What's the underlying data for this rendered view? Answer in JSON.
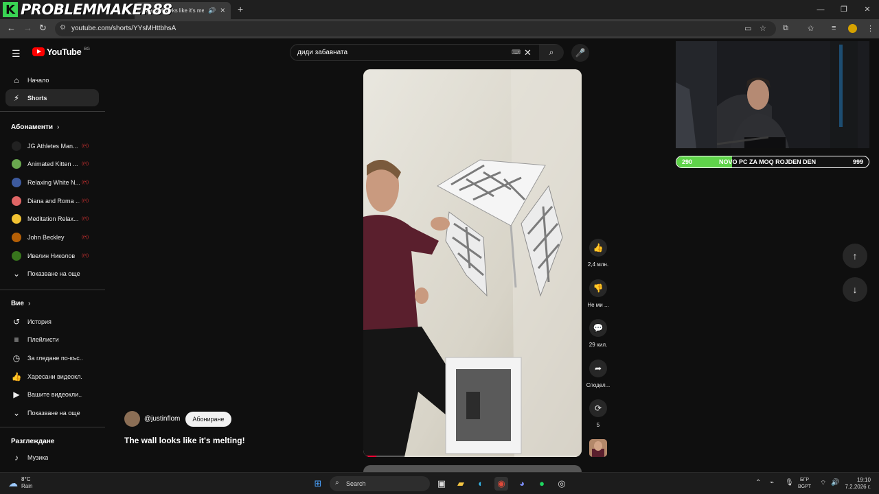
{
  "overlay": {
    "brand_letter": "K",
    "brand_name": "PROBLEMMAKER88"
  },
  "browser": {
    "tab_title": "The wall looks like it's melting",
    "url": "youtube.com/shorts/YYsMHttbhsA",
    "window_controls": [
      "—",
      "❐",
      "✕"
    ]
  },
  "youtube": {
    "logo_text": "YouTube",
    "region": "BG",
    "search_value": "диди забавната",
    "nav": [
      {
        "label": "Начало",
        "icon": "home-icon"
      },
      {
        "label": "Shorts",
        "icon": "shorts-icon",
        "active": true
      }
    ],
    "subscriptions_heading": "Абонаменти",
    "subscriptions": [
      {
        "label": "JG Athletes Man...",
        "color": "#222222",
        "live": true
      },
      {
        "label": "Animated Kitten ...",
        "color": "#6aa84f",
        "live": true
      },
      {
        "label": "Relaxing White N...",
        "color": "#3d5a9e",
        "live": true
      },
      {
        "label": "Diana and Roma ...",
        "color": "#e06666",
        "live": true
      },
      {
        "label": "Meditation Relax...",
        "color": "#f1c232",
        "live": true
      },
      {
        "label": "John Beckley",
        "color": "#b45f06",
        "live": true
      },
      {
        "label": "Ивелин Николов",
        "color": "#38761d",
        "live": true
      }
    ],
    "show_more": "Показване на още",
    "you_heading": "Вие",
    "you_items": [
      {
        "label": "История",
        "icon": "history-icon"
      },
      {
        "label": "Плейлисти",
        "icon": "playlists-icon"
      },
      {
        "label": "За гледане по-къс...",
        "icon": "watch-later-icon"
      },
      {
        "label": "Харесани видеокл...",
        "icon": "liked-icon"
      },
      {
        "label": "Вашите видеокли...",
        "icon": "your-videos-icon"
      },
      {
        "label": "Показване на още",
        "icon": "chevron-down-icon"
      }
    ],
    "explore_heading": "Разглеждане",
    "explore_items": [
      {
        "label": "Музика",
        "icon": "music-icon"
      }
    ],
    "short": {
      "channel": "@justinflom",
      "subscribe_label": "Абониране",
      "title": "The wall looks like it's melting!",
      "progress": 0.06,
      "actions": [
        {
          "name": "like-button",
          "icon": "👍",
          "label": "2,4 млн."
        },
        {
          "name": "dislike-button",
          "icon": "👎",
          "label": "Не ми ..."
        },
        {
          "name": "comments-button",
          "icon": "💬",
          "label": "29 хил."
        },
        {
          "name": "share-button",
          "icon": "➦",
          "label": "Сподел..."
        },
        {
          "name": "remix-button",
          "icon": "⟳",
          "label": "5"
        }
      ]
    }
  },
  "stream_goal": {
    "left": "290",
    "text": "NOVO PC ZA MOQ ROJDEN DEN",
    "right": "999",
    "progress": 0.29
  },
  "taskbar": {
    "weather_temp": "8°C",
    "weather_desc": "Rain",
    "search_placeholder": "Search",
    "lang_top": "БГР",
    "lang_bottom": "BGPT",
    "time": "19:10",
    "date": "7.2.2026 г."
  }
}
